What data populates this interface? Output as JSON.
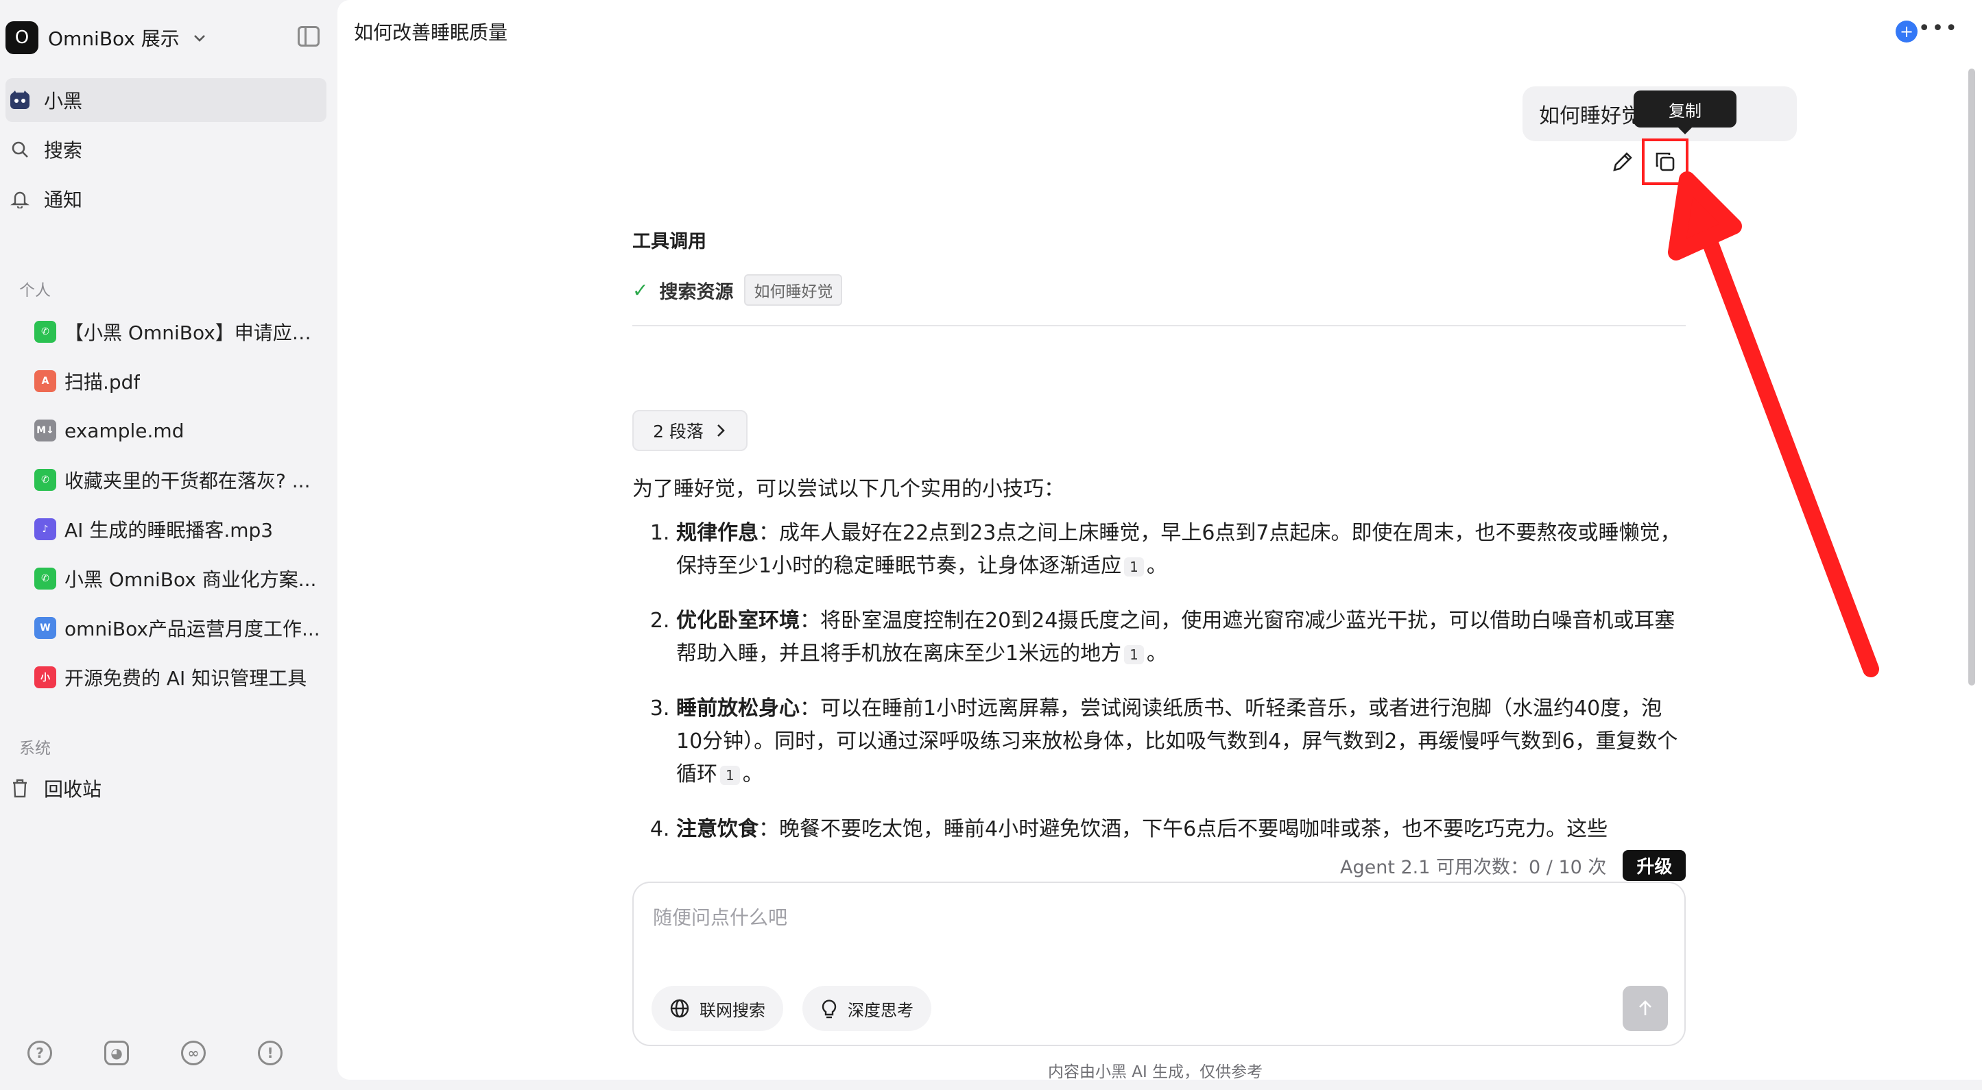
{
  "workspace": {
    "avatar": "O",
    "name": "OmniBox 展示"
  },
  "nav": [
    {
      "label": "小黑",
      "icon": "assistant-icon"
    },
    {
      "label": "搜索",
      "icon": "search-icon"
    },
    {
      "label": "通知",
      "icon": "bell-icon"
    }
  ],
  "sections": {
    "personal": "个人",
    "system": "系统"
  },
  "docs": [
    {
      "label": "【小黑 OmniBox】申请应聘...",
      "icon": "wechat-icon",
      "color": "#2ac151"
    },
    {
      "label": "扫描.pdf",
      "icon": "pdf-icon",
      "color": "#ee6a52"
    },
    {
      "label": "example.md",
      "icon": "markdown-icon",
      "color": "#8b8b91"
    },
    {
      "label": "收藏夹里的干货都在落灰? ...",
      "icon": "wechat-icon",
      "color": "#2ac151"
    },
    {
      "label": "AI 生成的睡眠播客.mp3",
      "icon": "audio-icon",
      "color": "#6a5de8"
    },
    {
      "label": "小黑 OmniBox 商业化方案...",
      "icon": "wechat-icon",
      "color": "#2ac151"
    },
    {
      "label": "omniBox产品运营月度工作...",
      "icon": "word-icon",
      "color": "#4a87e8"
    },
    {
      "label": "开源免费的 AI 知识管理工具",
      "icon": "xiaohongshu-icon",
      "color": "#f2374b"
    }
  ],
  "trash": {
    "label": "回收站"
  },
  "conversation": {
    "title": "如何改善睡眠质量"
  },
  "user_message": {
    "text": "如何睡好觉"
  },
  "tooltip": {
    "text": "复制"
  },
  "tool_call": {
    "title": "工具调用",
    "name": "搜索资源",
    "query": "如何睡好觉"
  },
  "paragraph_button": {
    "label": "2 段落"
  },
  "answer": {
    "intro": "为了睡好觉，可以尝试以下几个实用的小技巧：",
    "items": [
      {
        "title": "规律作息",
        "body": "：成年人最好在22点到23点之间上床睡觉，早上6点到7点起床。即使在周末，也不要熬夜或睡懒觉，保持至少1小时的稳定睡眠节奏，让身体逐渐适应",
        "cite": "1",
        "tail": "。"
      },
      {
        "title": "优化卧室环境",
        "body": "：将卧室温度控制在20到24摄氏度之间，使用遮光窗帘减少蓝光干扰，可以借助白噪音机或耳塞帮助入睡，并且将手机放在离床至少1米远的地方",
        "cite": "1",
        "tail": "。"
      },
      {
        "title": "睡前放松身心",
        "body": "：可以在睡前1小时远离屏幕，尝试阅读纸质书、听轻柔音乐，或者进行泡脚（水温约40度，泡10分钟）。同时，可以通过深呼吸练习来放松身体，比如吸气数到4，屏气数到2，再缓慢呼气数到6，重复数个循环",
        "cite": "1",
        "tail": "。"
      },
      {
        "title": "注意饮食",
        "body": "：晚餐不要吃太饱，睡前4小时避免饮酒，下午6点后不要喝咖啡或茶，也不要吃巧克力。这些",
        "cite": "",
        "tail": ""
      }
    ]
  },
  "usage": {
    "text": "Agent 2.1 可用次数：0 / 10 次",
    "upgrade": "升级"
  },
  "composer": {
    "placeholder": "随便问点什么吧",
    "web_search": "联网搜索",
    "deep_think": "深度思考"
  },
  "disclaimer": "内容由小黑 AI 生成，仅供参考",
  "colors": {
    "accent": "#3478f6",
    "annotation_red": "#ff1f1f",
    "check_green": "#2aa84a"
  }
}
